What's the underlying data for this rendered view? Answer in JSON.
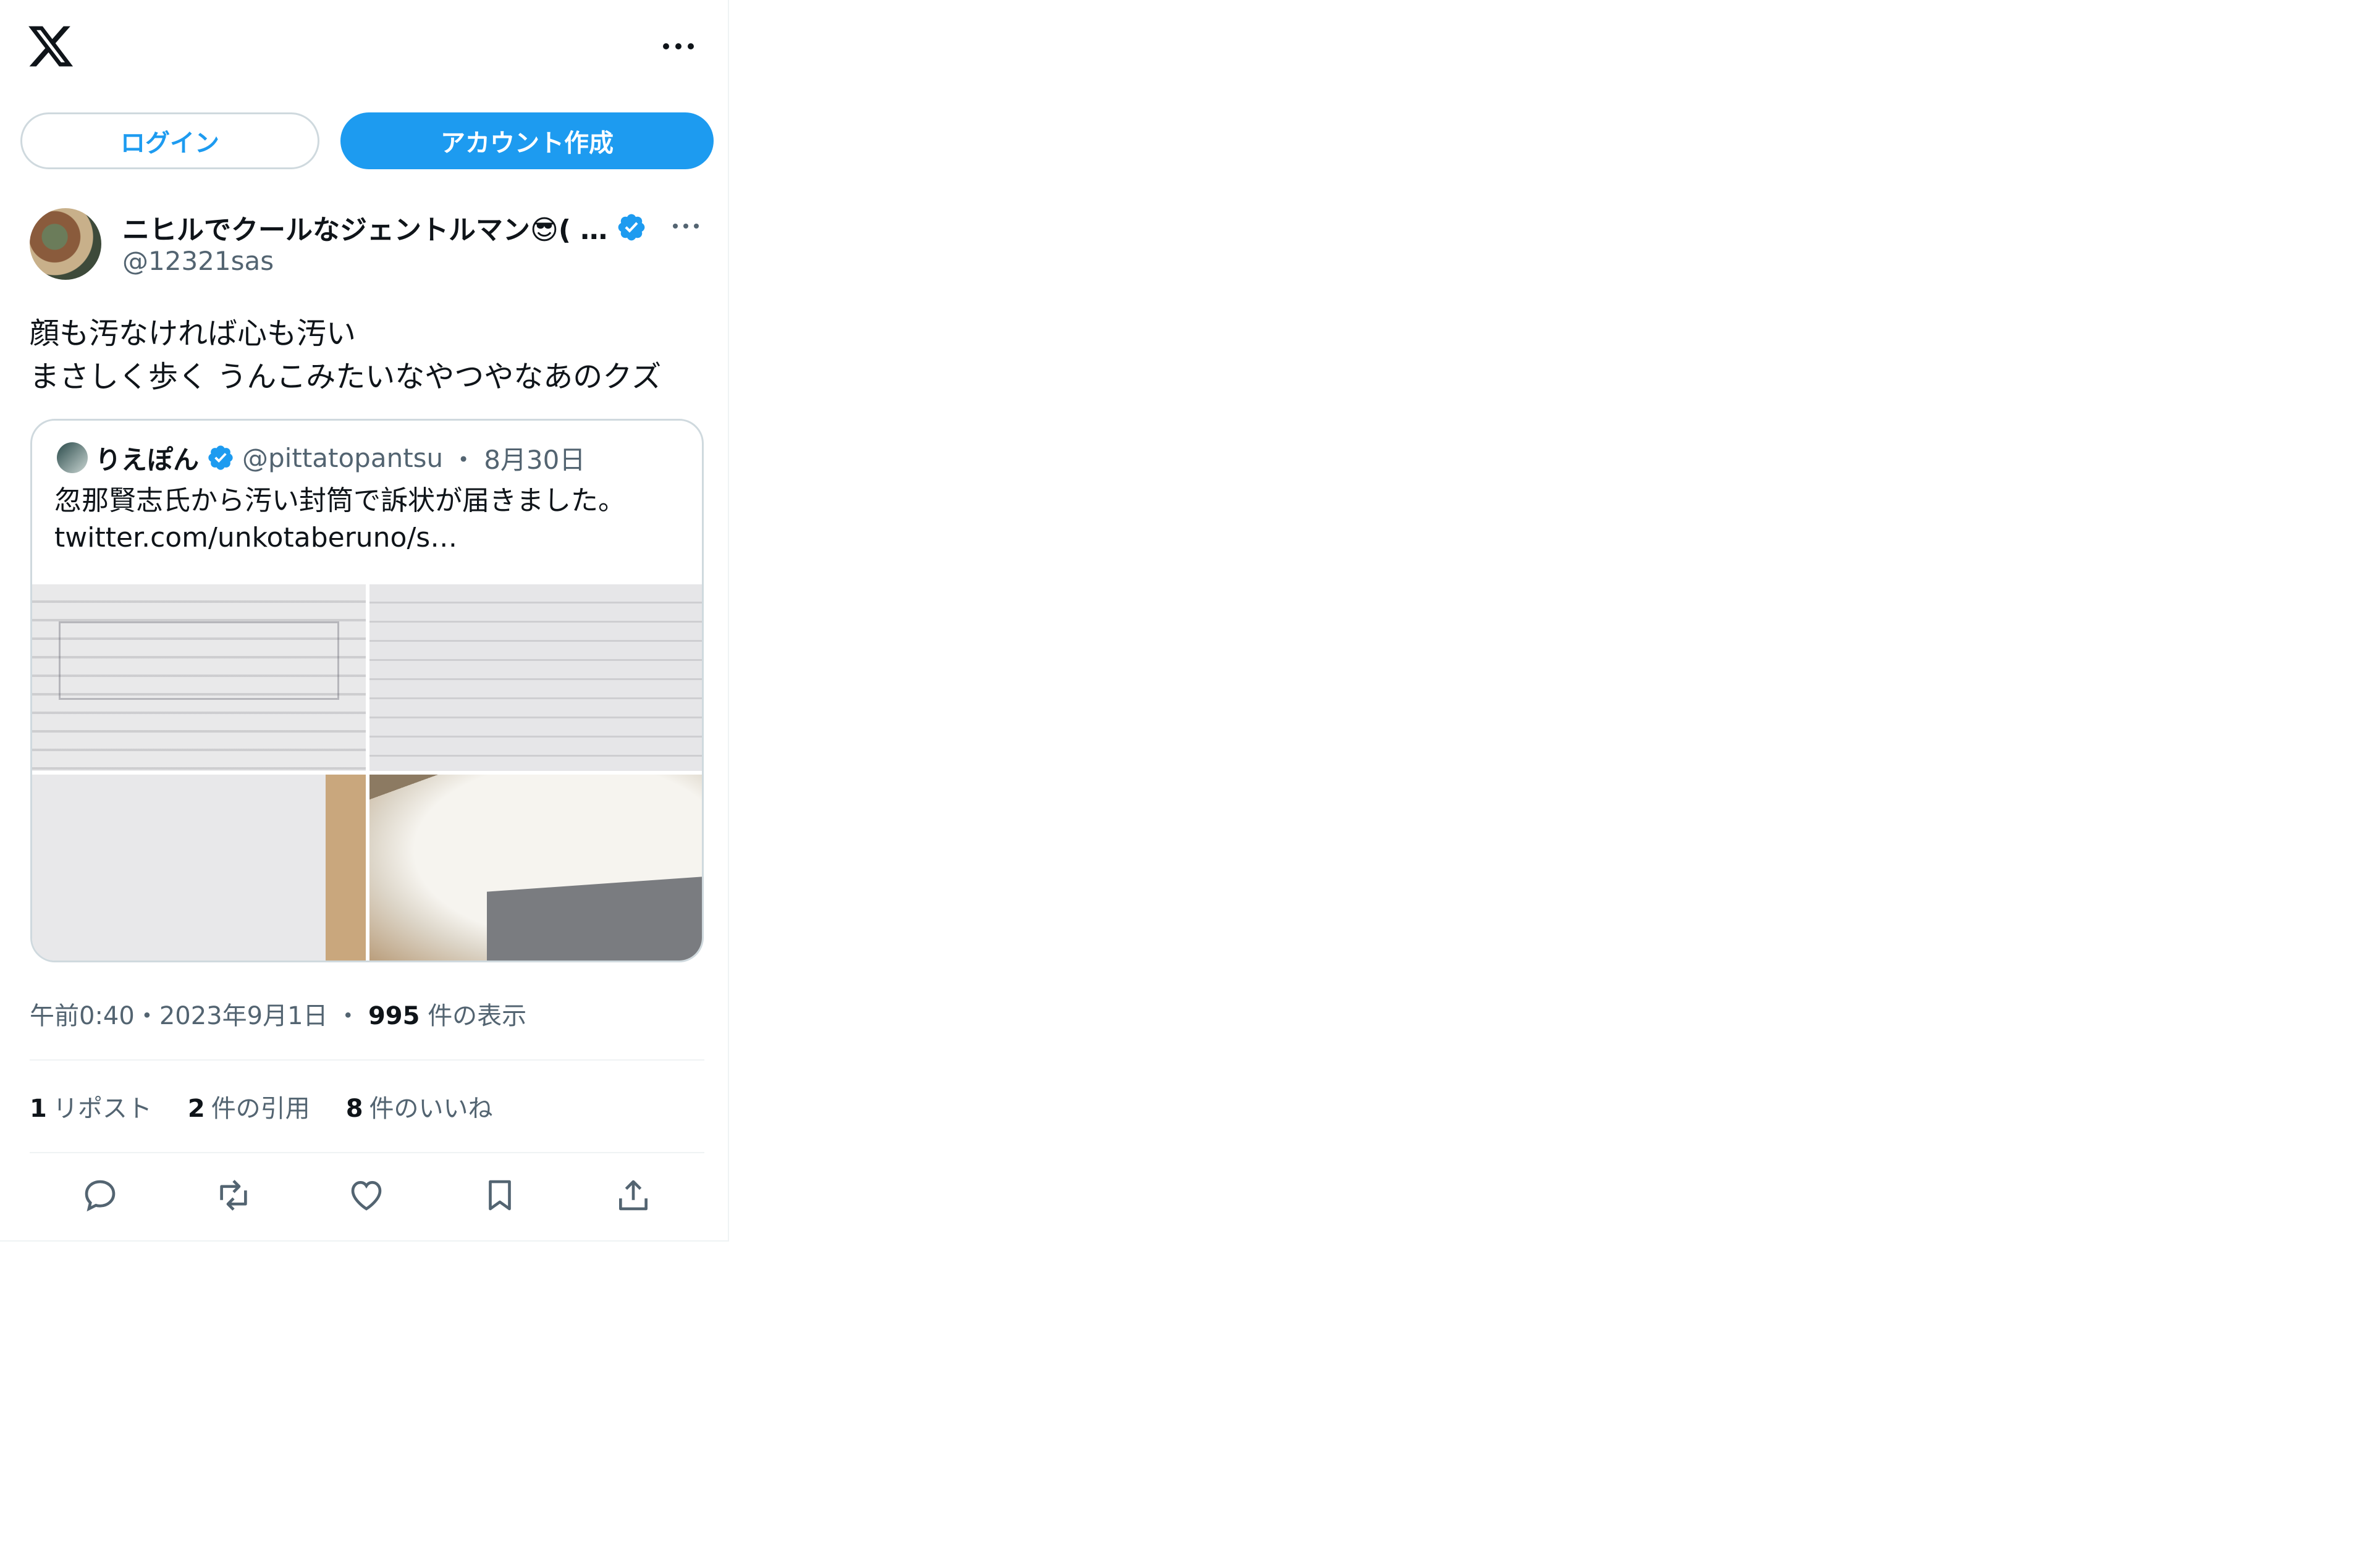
{
  "header": {
    "logo": "x-logo-icon",
    "more": "more-icon",
    "login_label": "ログイン",
    "signup_label": "アカウント作成"
  },
  "tweet": {
    "author_name": "ニヒルでクールなジェントルマン😎( …",
    "author_handle": "@12321sas",
    "text_line1": "顔も汚なければ心も汚い",
    "text_line2": "まさしく歩く うんこみたいなやつやなあのクズ",
    "time": "午前0:40",
    "sep1": "・",
    "date": "2023年9月1日",
    "sep2": "・",
    "views_count": "995",
    "views_label": "件の表示"
  },
  "quote": {
    "name": "りえぽん",
    "handle": "@pittatopantsu",
    "dot": "・",
    "date": "8月30日",
    "text_line1": "忽那賢志氏から汚い封筒で訴状が届きました。",
    "text_line2": "twitter.com/unkotaberuno/s…"
  },
  "stats": {
    "reposts_count": "1",
    "reposts_label": "リポスト",
    "quotes_count": "2",
    "quotes_label": "件の引用",
    "likes_count": "8",
    "likes_label": "件のいいね"
  },
  "actions": [
    "reply-icon",
    "repost-icon",
    "like-icon",
    "bookmark-icon",
    "share-icon"
  ],
  "colors": {
    "accent": "#1d9bf0",
    "text": "#0f1419",
    "muted": "#536471",
    "border": "#cfd9de"
  }
}
